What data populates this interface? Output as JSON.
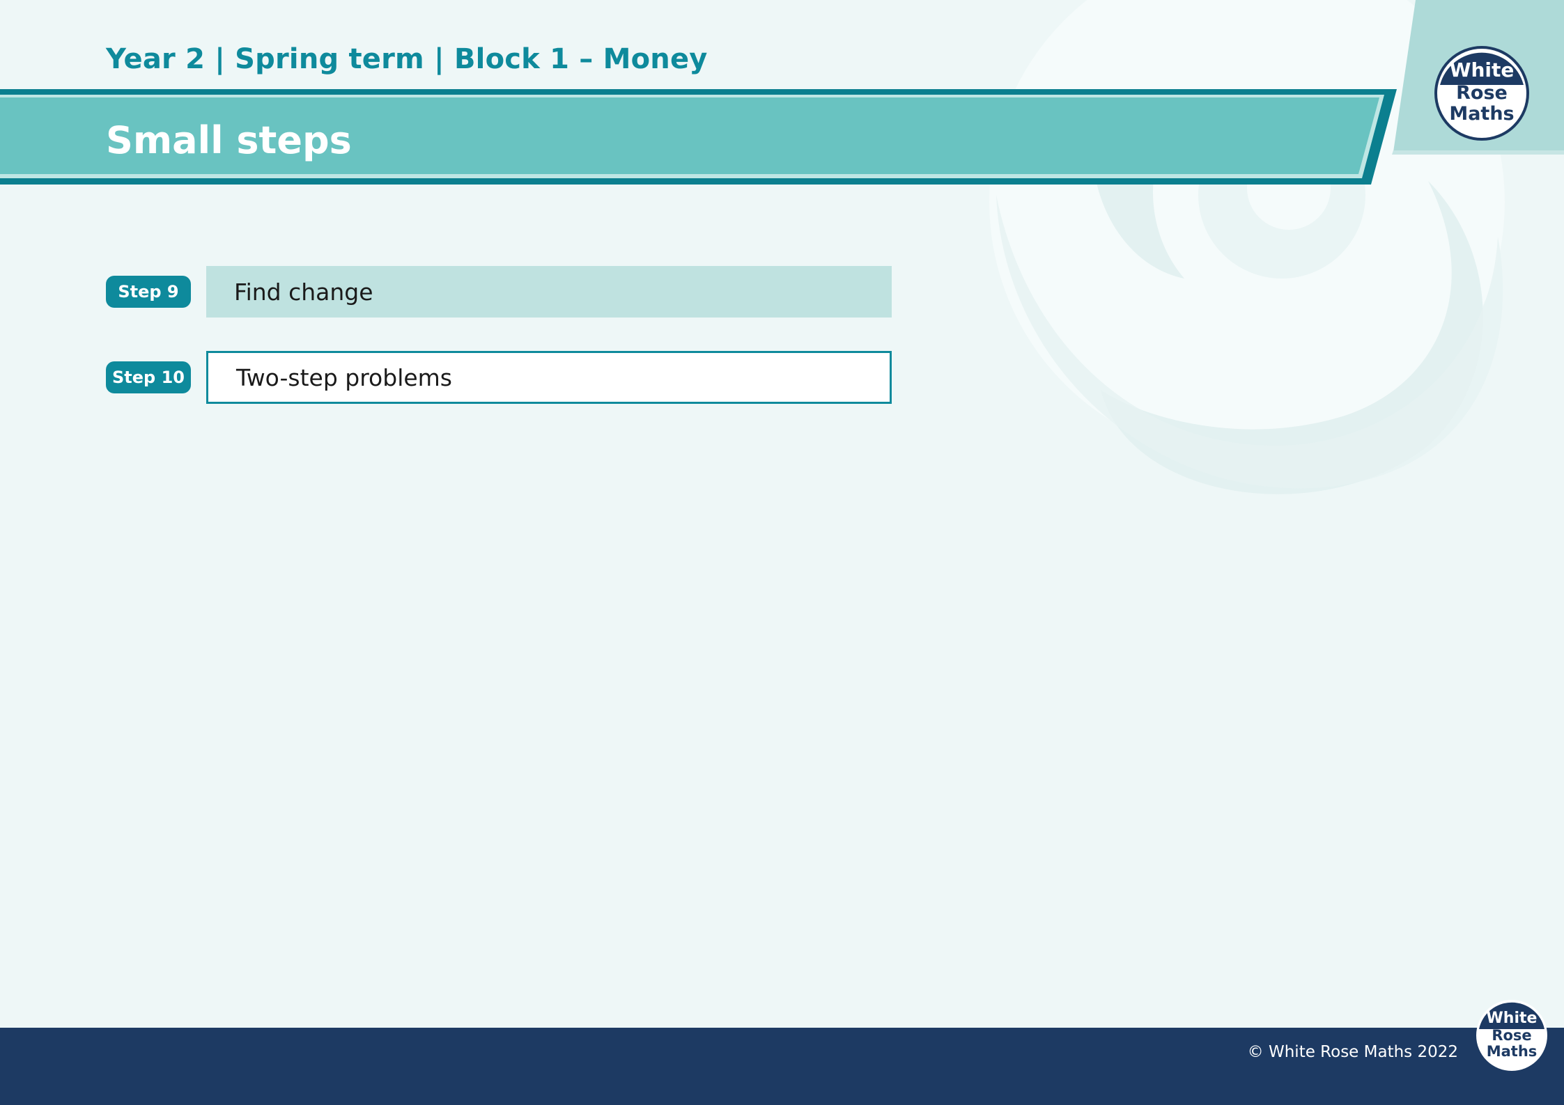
{
  "header": {
    "breadcrumb": "Year 2 | Spring term | Block 1 – Money",
    "title": "Small steps"
  },
  "logo": {
    "line1": "White",
    "line2": "Rose",
    "line3": "Maths"
  },
  "steps": [
    {
      "badge": "Step 9",
      "label": "Find change",
      "state": "highlighted"
    },
    {
      "badge": "Step 10",
      "label": "Two-step problems",
      "state": "outlined"
    }
  ],
  "footer": {
    "copyright": "© White Rose Maths 2022"
  },
  "colors": {
    "teal": "#0e8a9c",
    "banner": "#69c3c1",
    "navy": "#1d3a63",
    "background": "#eef7f7",
    "highlight": "#bfe2e0"
  }
}
